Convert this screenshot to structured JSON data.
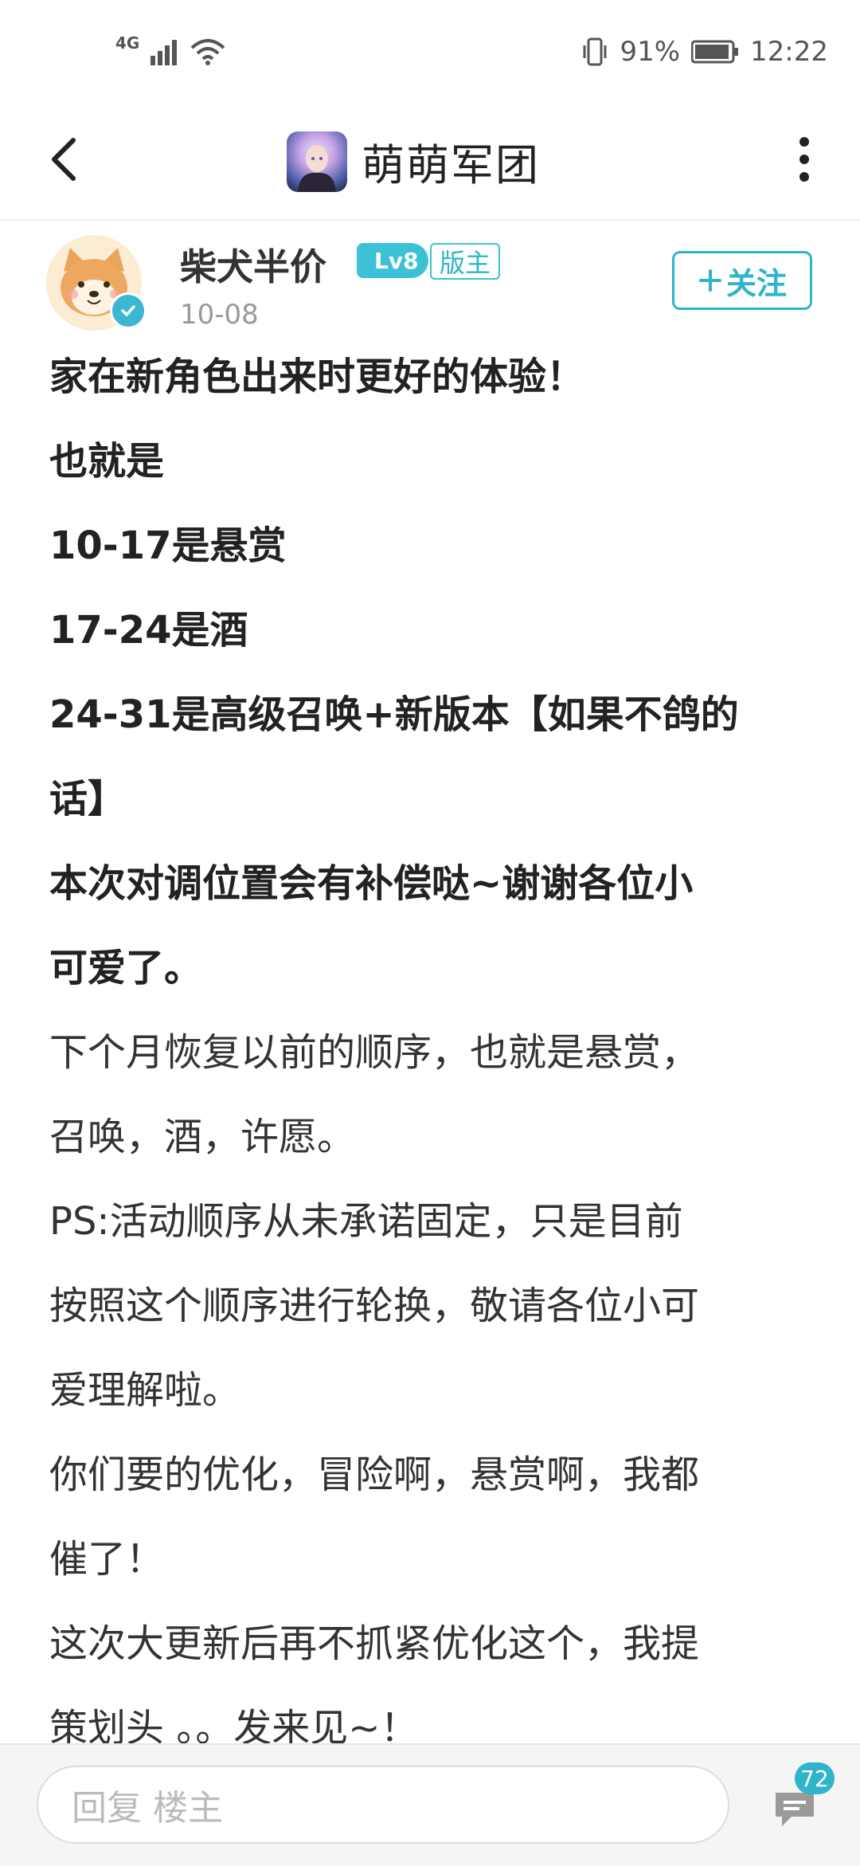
{
  "status_bar": {
    "network": "4G",
    "battery": "91%",
    "time": "12:22"
  },
  "nav": {
    "title": "萌萌军团"
  },
  "author": {
    "name": "柴犬半价",
    "level": "Lv8",
    "role": "版主",
    "date": "10-08",
    "follow_label": "关注"
  },
  "content": {
    "lines": [
      {
        "text": "家在新角色出来时更好的体验！",
        "bold": true
      },
      {
        "text": "也就是",
        "bold": true
      },
      {
        "text": "10-17是悬赏",
        "bold": true
      },
      {
        "text": "17-24是酒",
        "bold": true
      },
      {
        "text": "24-31是高级召唤+新版本【如果不鸽的",
        "bold": true
      },
      {
        "text": "话】",
        "bold": true
      },
      {
        "text": "本次对调位置会有补偿哒~谢谢各位小",
        "bold": true
      },
      {
        "text": "可爱了。",
        "bold": true
      },
      {
        "text": "下个月恢复以前的顺序，也就是悬赏，",
        "bold": false
      },
      {
        "text": "召唤，酒，许愿。",
        "bold": false
      },
      {
        "text": "PS:活动顺序从未承诺固定，只是目前",
        "bold": false
      },
      {
        "text": "按照这个顺序进行轮换，敬请各位小可",
        "bold": false
      },
      {
        "text": "爱理解啦。",
        "bold": false
      },
      {
        "text": "你们要的优化，冒险啊，悬赏啊，我都",
        "bold": false
      },
      {
        "text": "催了！",
        "bold": false
      },
      {
        "text": "这次大更新后再不抓紧优化这个，我提",
        "bold": false
      },
      {
        "text": "策划头 。。发来见~！",
        "bold": false
      }
    ]
  },
  "bottom": {
    "reply_placeholder": "回复  楼主",
    "comment_count": "72"
  },
  "colors": {
    "accent": "#2fb4c9",
    "level_badge": "#3cc1d6"
  }
}
